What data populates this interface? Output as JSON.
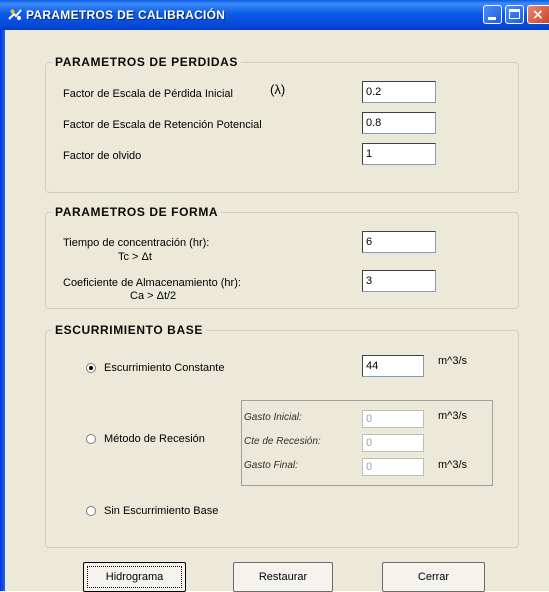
{
  "window": {
    "title": "PARAMETROS DE CALIBRACIÓN"
  },
  "perdidas": {
    "title": "PARAMETROS DE PERDIDAS",
    "factor_inicial_label": "Factor de Escala de Pérdida Inicial",
    "lambda_symbol": "(λ)",
    "factor_inicial_value": "0.2",
    "factor_retencion_label": "Factor de Escala de Retención Potencial",
    "factor_retencion_value": "0.8",
    "factor_olvido_label": "Factor de olvido",
    "factor_olvido_value": "1"
  },
  "forma": {
    "title": "PARAMETROS DE FORMA",
    "tiempo_label": "Tiempo de concentración (hr):",
    "tiempo_cond": "Tc > Δt",
    "tiempo_value": "6",
    "coef_label": "Coeficiente de Almacenamiento (hr):",
    "coef_cond": "Ca > Δt/2",
    "coef_value": "3"
  },
  "base": {
    "title": "ESCURRIMIENTO BASE",
    "opt_constante": "Escurrimiento Constante",
    "constante_value": "44",
    "unit": "m^3/s",
    "opt_recesion": "Método de Recesión",
    "gasto_inicial_label": "Gasto Inicial:",
    "gasto_inicial_value": "0",
    "cte_recesion_label": "Cte de Recesión:",
    "cte_recesion_value": "0",
    "gasto_final_label": "Gasto Final:",
    "gasto_final_value": "0",
    "opt_sin": "Sin Escurrimiento Base",
    "selected": "constante"
  },
  "buttons": {
    "hidrograma": "Hidrograma",
    "restaurar": "Restaurar",
    "cerrar": "Cerrar"
  }
}
